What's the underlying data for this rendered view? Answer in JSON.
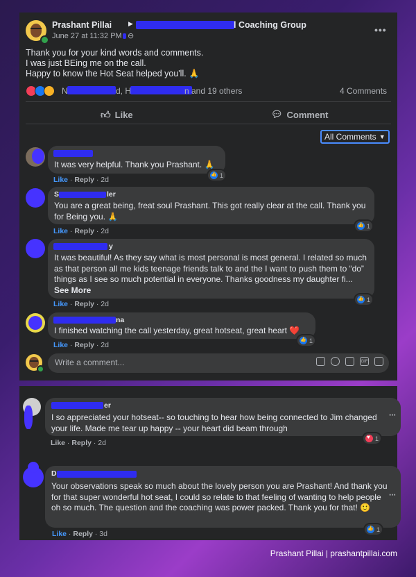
{
  "post": {
    "author": "Prashant Pillai",
    "group_suffix": "l Coaching Group",
    "timestamp": "June 27 at 11:32 PM",
    "body": [
      "Thank you for your kind words and comments.",
      "I was just BEing me on the call.",
      "Happy to know the Hot Seat helped you'll. 🙏"
    ],
    "reactions_prefix": "N",
    "reactions_mid": "d, H",
    "reactions_suffix": "n and 19 others",
    "comment_count": "4 Comments",
    "like_label": "Like",
    "comment_label": "Comment",
    "more_label": "•••"
  },
  "filter": {
    "label": "All Comments"
  },
  "comments": [
    {
      "name_visible": "",
      "text": "It was very helpful. Thank you Prashant. 🙏",
      "like": "Like",
      "reply": "Reply",
      "time": "2d",
      "reaction_count": "1"
    },
    {
      "name_visible_start": "S",
      "name_visible_end": "ler",
      "text": "You are a great being, freat soul Prashant. This got really clear at the call. Thank you for Being you. 🙏",
      "like": "Like",
      "reply": "Reply",
      "time": "2d",
      "reaction_count": "1"
    },
    {
      "name_visible_end": "y",
      "text": "It was beautiful! As they say what is most personal is most general. I related so much as that person all me kids teenage friends talk to and the I want to push them to “do” things as I see so much potential in everyone. Thanks goodness my daughter fi...",
      "see_more": "See More",
      "like": "Like",
      "reply": "Reply",
      "time": "2d",
      "reaction_count": "1"
    },
    {
      "name_visible_end": "na",
      "text": "I finished watching the call yesterday, great hotseat, great heart ❤️",
      "like": "Like",
      "reply": "Reply",
      "time": "2d",
      "reaction_count": "1"
    }
  ],
  "write_comment": {
    "placeholder": "Write a comment..."
  },
  "comments2": [
    {
      "name_visible_end": "er",
      "text": "I so appreciated your hotseat-- so touching to hear how being connected to Jim changed your life. Made me tear up happy -- your heart did beam through",
      "like": "Like",
      "reply": "Reply",
      "time": "2d",
      "reaction_count": "1"
    },
    {
      "name_visible_start": "D",
      "text": "Your observations speak so much about the lovely person you are Prashant! And thank you for that super wonderful hot seat, I could so relate to that feeling of wanting to help people oh so much. The question and the coaching was power packed. Thank you for that! 🙂",
      "like": "Like",
      "reply": "Reply",
      "time": "3d",
      "reaction_count": "1"
    }
  ],
  "footer": {
    "credit": "Prashant Pillai | prashantpillai.com"
  },
  "colors": {
    "panel": "#242526",
    "bubble": "#3a3b3c",
    "link_blue": "#4599ff",
    "redaction": "#2f2cf0"
  }
}
